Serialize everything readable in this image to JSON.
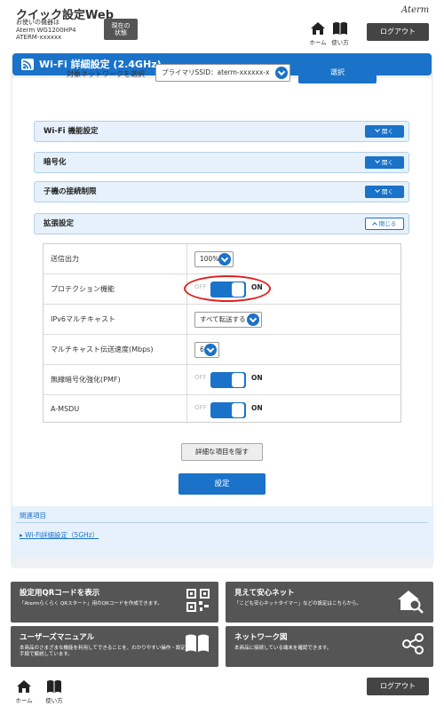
{
  "header": {
    "title": "クイック設定Web",
    "model_line1": "お使いの機器は",
    "model_line2": "Aterm WG1200HP4",
    "model_line3": "ATERM-xxxxxx",
    "status_button_line1": "現在の",
    "status_button_line2": "状態",
    "home_label": "ホーム",
    "manual_label": "使い方",
    "brand": "Aterm",
    "logout_label": "ログアウト"
  },
  "page": {
    "section_title": "Wi-Fi 詳細設定 (2.4GHz)",
    "network_select_label": "対象ネットワークを選択",
    "network_select_value": "プライマリSSID：aterm-xxxxxx-x",
    "select_button": "選択"
  },
  "accordions": [
    {
      "label": "Wi-Fi 機能設定",
      "button": "開く",
      "state": "collapsed"
    },
    {
      "label": "暗号化",
      "button": "開く",
      "state": "collapsed"
    },
    {
      "label": "子機の接続制限",
      "button": "開く",
      "state": "collapsed"
    },
    {
      "label": "拡張設定",
      "button": "閉じる",
      "state": "expanded"
    }
  ],
  "settings": {
    "tx_power": {
      "label": "送信出力",
      "value": "100%"
    },
    "protection": {
      "label": "プロテクション機能",
      "off": "OFF",
      "on": "ON",
      "state": "on"
    },
    "ipv6_multicast": {
      "label": "IPv6マルチキャスト",
      "value": "すべて転送する"
    },
    "multicast_rate": {
      "label": "マルチキャスト伝送速度(Mbps)",
      "value": "6"
    },
    "pmf": {
      "label": "無線暗号化強化(PMF)",
      "off": "OFF",
      "on": "ON",
      "state": "on"
    },
    "amsdu": {
      "label": "A-MSDU",
      "off": "OFF",
      "on": "ON",
      "state": "on"
    }
  },
  "actions": {
    "hide_details": "詳細な項目を隠す",
    "apply": "設定"
  },
  "related": {
    "title": "関連項目",
    "link": "Wi-Fi詳細設定（5GHz）"
  },
  "tiles": {
    "qr": {
      "title": "設定用QRコードを表示",
      "desc": "「Atermらくらく QRスタート」用のQRコードを作成できます。"
    },
    "kids": {
      "title": "見えて安心ネット",
      "desc": "「こども安心ネットタイマー」などの設定はこちらから。"
    },
    "manual": {
      "title": "ユーザーズマニュアル",
      "desc": "本商品のさまざまな機能を利用してできることを、わかりやすい操作・設定手順で解説しています。"
    },
    "network_map": {
      "title": "ネットワーク図",
      "desc": "本商品に接続している端末を確認できます。"
    }
  },
  "footer": {
    "home_label": "ホーム",
    "manual_label": "使い方",
    "logout_label": "ログアウト"
  },
  "colors": {
    "accent": "#1a72c9",
    "panel_bg": "#eef1f4",
    "tile_bg": "#555555",
    "highlight": "#e02020"
  }
}
